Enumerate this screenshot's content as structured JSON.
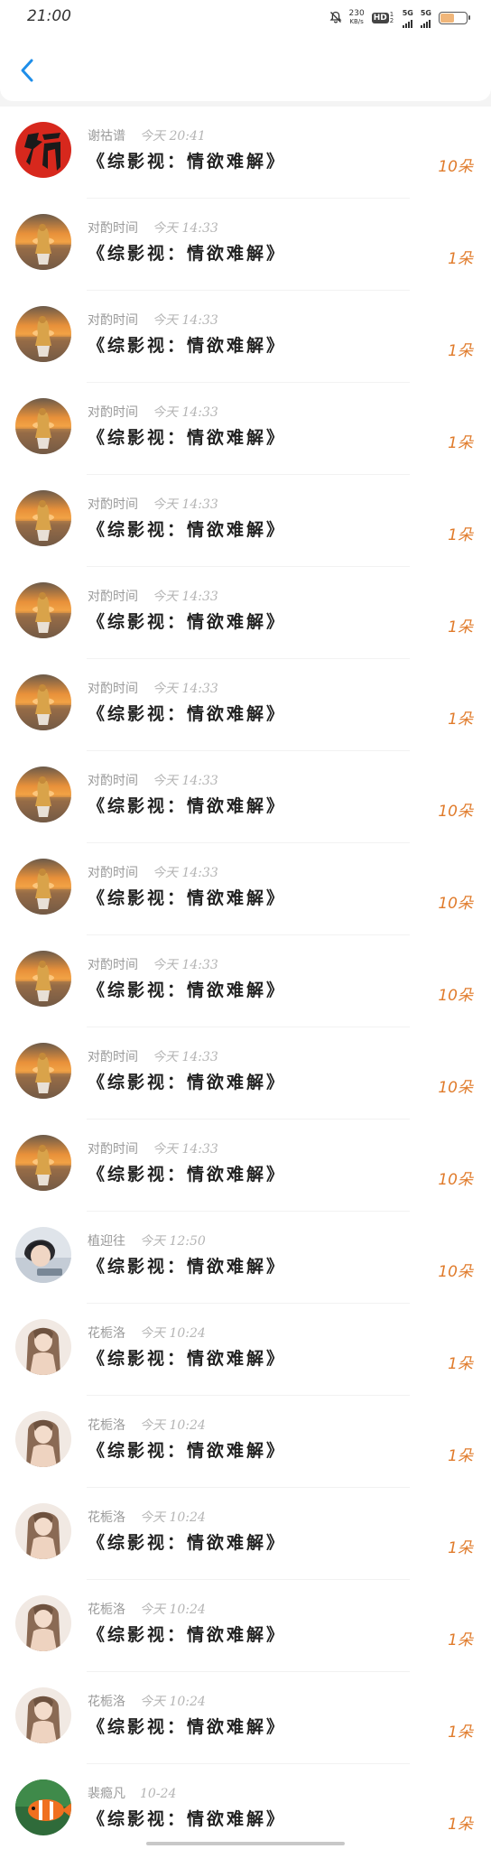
{
  "status_bar": {
    "time": "21:00",
    "speed_top": "230",
    "speed_unit": "KB/s",
    "hd_label": "HD",
    "hd_sub": "1 2",
    "network_1": "5G",
    "network_2": "5G",
    "battery_level": 0.55,
    "icons": [
      "mute-bell-icon",
      "hd-icon",
      "signal-icon",
      "signal-icon",
      "battery-icon"
    ]
  },
  "header": {
    "back_icon": "chevron-left-icon",
    "accent_color": "#1e8ee9"
  },
  "colors": {
    "count_color": "#e07b2b"
  },
  "messages": [
    {
      "name": "谢祜谱",
      "time": "今天 20:41",
      "title": "《综影视：情欲难解》",
      "count": "10朵",
      "avatar": "fu-character"
    },
    {
      "name": "对酌时间",
      "time": "今天 14:33",
      "title": "《综影视：情欲难解》",
      "count": "1朵",
      "avatar": "sunset-figure"
    },
    {
      "name": "对酌时间",
      "time": "今天 14:33",
      "title": "《综影视：情欲难解》",
      "count": "1朵",
      "avatar": "sunset-figure"
    },
    {
      "name": "对酌时间",
      "time": "今天 14:33",
      "title": "《综影视：情欲难解》",
      "count": "1朵",
      "avatar": "sunset-figure"
    },
    {
      "name": "对酌时间",
      "time": "今天 14:33",
      "title": "《综影视：情欲难解》",
      "count": "1朵",
      "avatar": "sunset-figure"
    },
    {
      "name": "对酌时间",
      "time": "今天 14:33",
      "title": "《综影视：情欲难解》",
      "count": "1朵",
      "avatar": "sunset-figure"
    },
    {
      "name": "对酌时间",
      "time": "今天 14:33",
      "title": "《综影视：情欲难解》",
      "count": "1朵",
      "avatar": "sunset-figure"
    },
    {
      "name": "对酌时间",
      "time": "今天 14:33",
      "title": "《综影视：情欲难解》",
      "count": "10朵",
      "avatar": "sunset-figure"
    },
    {
      "name": "对酌时间",
      "time": "今天 14:33",
      "title": "《综影视：情欲难解》",
      "count": "10朵",
      "avatar": "sunset-figure"
    },
    {
      "name": "对酌时间",
      "time": "今天 14:33",
      "title": "《综影视：情欲难解》",
      "count": "10朵",
      "avatar": "sunset-figure"
    },
    {
      "name": "对酌时间",
      "time": "今天 14:33",
      "title": "《综影视：情欲难解》",
      "count": "10朵",
      "avatar": "sunset-figure"
    },
    {
      "name": "对酌时间",
      "time": "今天 14:33",
      "title": "《综影视：情欲难解》",
      "count": "10朵",
      "avatar": "sunset-figure"
    },
    {
      "name": "植迎往",
      "time": "今天 12:50",
      "title": "《综影视：情欲难解》",
      "count": "10朵",
      "avatar": "boy-photo"
    },
    {
      "name": "花栀洛",
      "time": "今天 10:24",
      "title": "《综影视：情欲难解》",
      "count": "1朵",
      "avatar": "girl-photo"
    },
    {
      "name": "花栀洛",
      "time": "今天 10:24",
      "title": "《综影视：情欲难解》",
      "count": "1朵",
      "avatar": "girl-photo"
    },
    {
      "name": "花栀洛",
      "time": "今天 10:24",
      "title": "《综影视：情欲难解》",
      "count": "1朵",
      "avatar": "girl-photo"
    },
    {
      "name": "花栀洛",
      "time": "今天 10:24",
      "title": "《综影视：情欲难解》",
      "count": "1朵",
      "avatar": "girl-photo"
    },
    {
      "name": "花栀洛",
      "time": "今天 10:24",
      "title": "《综影视：情欲难解》",
      "count": "1朵",
      "avatar": "girl-photo"
    },
    {
      "name": "裴瘾凡",
      "time": "10-24",
      "title": "《综影视：情欲难解》",
      "count": "1朵",
      "avatar": "clownfish"
    }
  ]
}
